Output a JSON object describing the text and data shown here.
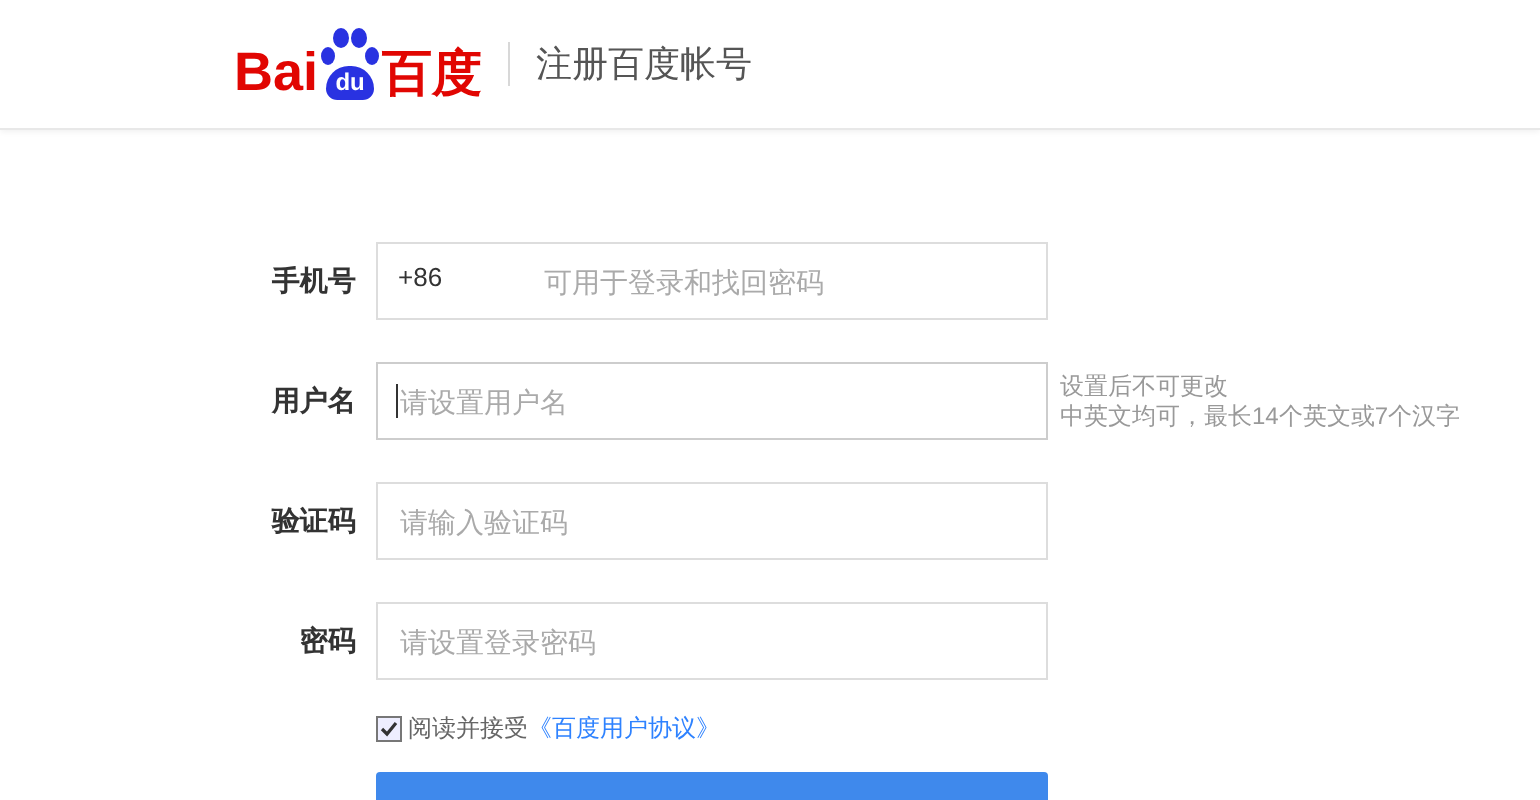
{
  "header": {
    "logo": {
      "left": "Bai",
      "badge": "du",
      "right": "百度"
    },
    "title": "注册百度帐号"
  },
  "form": {
    "fields": [
      {
        "kind": "phone",
        "label": "手机号",
        "prefix": "+86",
        "placeholder": "可用于登录和找回密码",
        "focused": false
      },
      {
        "kind": "text",
        "label": "用户名",
        "placeholder": "请设置用户名",
        "focused": true,
        "hints": [
          "设置后不可更改",
          "中英文均可，最长14个英文或7个汉字"
        ]
      },
      {
        "kind": "text",
        "label": "验证码",
        "placeholder": "请输入验证码",
        "focused": false
      },
      {
        "kind": "text",
        "label": "密码",
        "placeholder": "请设置登录密码",
        "focused": false
      }
    ],
    "agreement": {
      "checked": true,
      "text": "阅读并接受",
      "link": "《百度用户协议》"
    }
  }
}
